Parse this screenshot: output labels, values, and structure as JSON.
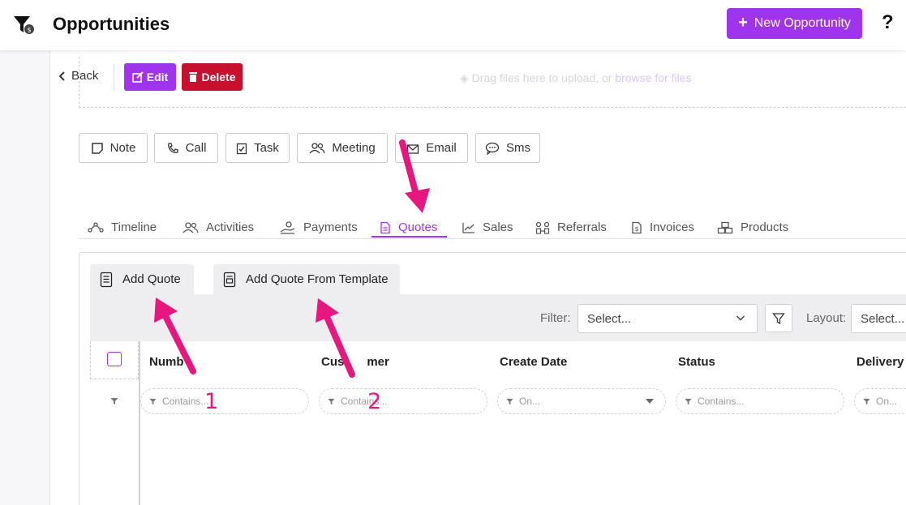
{
  "header": {
    "title": "Opportunities",
    "new_button": "New Opportunity",
    "help": "?"
  },
  "actions": {
    "back": "Back",
    "edit": "Edit",
    "delete": "Delete"
  },
  "dropzone": {
    "text": "Drag files here to upload, or",
    "link": "browse for files"
  },
  "activity_buttons": [
    {
      "label": "Note",
      "icon": "sticky-note-icon"
    },
    {
      "label": "Call",
      "icon": "phone-icon"
    },
    {
      "label": "Task",
      "icon": "clipboard-check-icon"
    },
    {
      "label": "Meeting",
      "icon": "users-icon"
    },
    {
      "label": "Email",
      "icon": "envelope-icon"
    },
    {
      "label": "Sms",
      "icon": "sms-bubble-icon"
    }
  ],
  "tabs": [
    {
      "label": "Timeline",
      "icon": "timeline-icon"
    },
    {
      "label": "Activities",
      "icon": "users-icon"
    },
    {
      "label": "Payments",
      "icon": "hand-coin-icon"
    },
    {
      "label": "Quotes",
      "icon": "document-icon",
      "active": true
    },
    {
      "label": "Sales",
      "icon": "line-chart-icon"
    },
    {
      "label": "Referrals",
      "icon": "referral-icon"
    },
    {
      "label": "Invoices",
      "icon": "invoice-icon"
    },
    {
      "label": "Products",
      "icon": "boxes-icon"
    }
  ],
  "quotes": {
    "add_quote": "Add Quote",
    "add_from_template": "Add Quote From Template",
    "filter_label": "Filter:",
    "filter_placeholder": "Select...",
    "layout_label": "Layout:",
    "layout_placeholder": "Select..."
  },
  "grid": {
    "columns": [
      "Numb",
      "Cus",
      "mer",
      "Create Date",
      "Status",
      "Delivery"
    ],
    "filters": [
      "Contains...",
      "Contains...",
      "On...",
      "Contains...",
      "On..."
    ]
  },
  "annotations": {
    "one": "1",
    "two": "2",
    "color": "#e8177f"
  },
  "colors": {
    "accent": "#a033ec",
    "danger": "#c8102e"
  }
}
